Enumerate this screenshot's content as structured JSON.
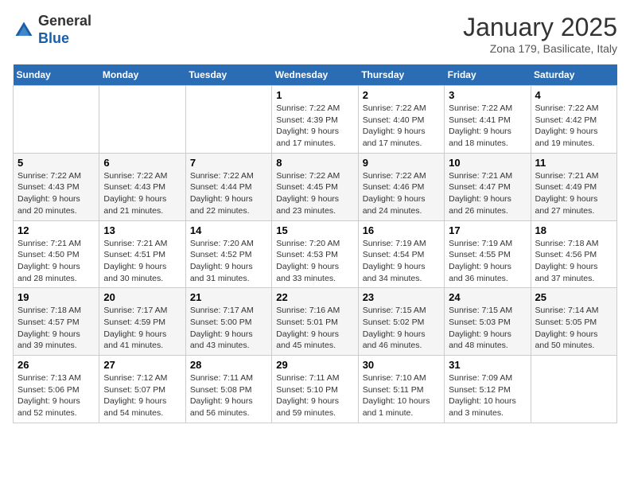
{
  "header": {
    "logo_general": "General",
    "logo_blue": "Blue",
    "month": "January 2025",
    "location": "Zona 179, Basilicate, Italy"
  },
  "weekdays": [
    "Sunday",
    "Monday",
    "Tuesday",
    "Wednesday",
    "Thursday",
    "Friday",
    "Saturday"
  ],
  "weeks": [
    [
      {
        "day": "",
        "info": ""
      },
      {
        "day": "",
        "info": ""
      },
      {
        "day": "",
        "info": ""
      },
      {
        "day": "1",
        "info": "Sunrise: 7:22 AM\nSunset: 4:39 PM\nDaylight: 9 hours\nand 17 minutes."
      },
      {
        "day": "2",
        "info": "Sunrise: 7:22 AM\nSunset: 4:40 PM\nDaylight: 9 hours\nand 17 minutes."
      },
      {
        "day": "3",
        "info": "Sunrise: 7:22 AM\nSunset: 4:41 PM\nDaylight: 9 hours\nand 18 minutes."
      },
      {
        "day": "4",
        "info": "Sunrise: 7:22 AM\nSunset: 4:42 PM\nDaylight: 9 hours\nand 19 minutes."
      }
    ],
    [
      {
        "day": "5",
        "info": "Sunrise: 7:22 AM\nSunset: 4:43 PM\nDaylight: 9 hours\nand 20 minutes."
      },
      {
        "day": "6",
        "info": "Sunrise: 7:22 AM\nSunset: 4:43 PM\nDaylight: 9 hours\nand 21 minutes."
      },
      {
        "day": "7",
        "info": "Sunrise: 7:22 AM\nSunset: 4:44 PM\nDaylight: 9 hours\nand 22 minutes."
      },
      {
        "day": "8",
        "info": "Sunrise: 7:22 AM\nSunset: 4:45 PM\nDaylight: 9 hours\nand 23 minutes."
      },
      {
        "day": "9",
        "info": "Sunrise: 7:22 AM\nSunset: 4:46 PM\nDaylight: 9 hours\nand 24 minutes."
      },
      {
        "day": "10",
        "info": "Sunrise: 7:21 AM\nSunset: 4:47 PM\nDaylight: 9 hours\nand 26 minutes."
      },
      {
        "day": "11",
        "info": "Sunrise: 7:21 AM\nSunset: 4:49 PM\nDaylight: 9 hours\nand 27 minutes."
      }
    ],
    [
      {
        "day": "12",
        "info": "Sunrise: 7:21 AM\nSunset: 4:50 PM\nDaylight: 9 hours\nand 28 minutes."
      },
      {
        "day": "13",
        "info": "Sunrise: 7:21 AM\nSunset: 4:51 PM\nDaylight: 9 hours\nand 30 minutes."
      },
      {
        "day": "14",
        "info": "Sunrise: 7:20 AM\nSunset: 4:52 PM\nDaylight: 9 hours\nand 31 minutes."
      },
      {
        "day": "15",
        "info": "Sunrise: 7:20 AM\nSunset: 4:53 PM\nDaylight: 9 hours\nand 33 minutes."
      },
      {
        "day": "16",
        "info": "Sunrise: 7:19 AM\nSunset: 4:54 PM\nDaylight: 9 hours\nand 34 minutes."
      },
      {
        "day": "17",
        "info": "Sunrise: 7:19 AM\nSunset: 4:55 PM\nDaylight: 9 hours\nand 36 minutes."
      },
      {
        "day": "18",
        "info": "Sunrise: 7:18 AM\nSunset: 4:56 PM\nDaylight: 9 hours\nand 37 minutes."
      }
    ],
    [
      {
        "day": "19",
        "info": "Sunrise: 7:18 AM\nSunset: 4:57 PM\nDaylight: 9 hours\nand 39 minutes."
      },
      {
        "day": "20",
        "info": "Sunrise: 7:17 AM\nSunset: 4:59 PM\nDaylight: 9 hours\nand 41 minutes."
      },
      {
        "day": "21",
        "info": "Sunrise: 7:17 AM\nSunset: 5:00 PM\nDaylight: 9 hours\nand 43 minutes."
      },
      {
        "day": "22",
        "info": "Sunrise: 7:16 AM\nSunset: 5:01 PM\nDaylight: 9 hours\nand 45 minutes."
      },
      {
        "day": "23",
        "info": "Sunrise: 7:15 AM\nSunset: 5:02 PM\nDaylight: 9 hours\nand 46 minutes."
      },
      {
        "day": "24",
        "info": "Sunrise: 7:15 AM\nSunset: 5:03 PM\nDaylight: 9 hours\nand 48 minutes."
      },
      {
        "day": "25",
        "info": "Sunrise: 7:14 AM\nSunset: 5:05 PM\nDaylight: 9 hours\nand 50 minutes."
      }
    ],
    [
      {
        "day": "26",
        "info": "Sunrise: 7:13 AM\nSunset: 5:06 PM\nDaylight: 9 hours\nand 52 minutes."
      },
      {
        "day": "27",
        "info": "Sunrise: 7:12 AM\nSunset: 5:07 PM\nDaylight: 9 hours\nand 54 minutes."
      },
      {
        "day": "28",
        "info": "Sunrise: 7:11 AM\nSunset: 5:08 PM\nDaylight: 9 hours\nand 56 minutes."
      },
      {
        "day": "29",
        "info": "Sunrise: 7:11 AM\nSunset: 5:10 PM\nDaylight: 9 hours\nand 59 minutes."
      },
      {
        "day": "30",
        "info": "Sunrise: 7:10 AM\nSunset: 5:11 PM\nDaylight: 10 hours\nand 1 minute."
      },
      {
        "day": "31",
        "info": "Sunrise: 7:09 AM\nSunset: 5:12 PM\nDaylight: 10 hours\nand 3 minutes."
      },
      {
        "day": "",
        "info": ""
      }
    ]
  ]
}
